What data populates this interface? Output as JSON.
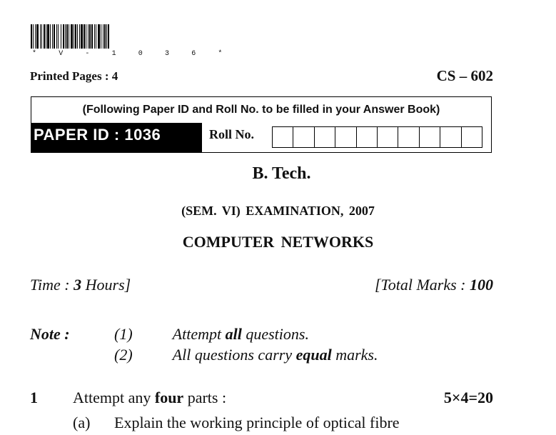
{
  "barcode": {
    "text": "*V-1036*",
    "spaced_text": "* V - 1 0 3 6 *"
  },
  "header": {
    "printed_pages_label": "Printed Pages : 4",
    "paper_code": "CS – 602"
  },
  "id_box": {
    "instruction": "(Following Paper ID and Roll No. to be filled in your Answer Book)",
    "paper_id": "PAPER ID : 1036",
    "roll_label": "Roll No.",
    "roll_box_count": 10
  },
  "exam": {
    "degree": "B. Tech.",
    "session": "(SEM. VI) EXAMINATION, 2007",
    "subject": "COMPUTER NETWORKS"
  },
  "meta": {
    "time_prefix": "Time : ",
    "time_value": "3",
    "time_suffix": " Hours]",
    "marks_prefix": "[Total Marks : ",
    "marks_value": "100"
  },
  "note": {
    "label": "Note :",
    "items": [
      {
        "num": "(1)",
        "pre": "Attempt ",
        "emph": "all",
        "post": " questions."
      },
      {
        "num": "(2)",
        "pre": "All questions carry ",
        "emph": "equal",
        "post": " marks."
      }
    ]
  },
  "questions": [
    {
      "number": "1",
      "pre": "Attempt any ",
      "emph": "four",
      "post": " parts :",
      "marks": "5×4=20",
      "parts": [
        {
          "label": "(a)",
          "text": "Explain the working principle of optical fibre"
        }
      ]
    }
  ]
}
